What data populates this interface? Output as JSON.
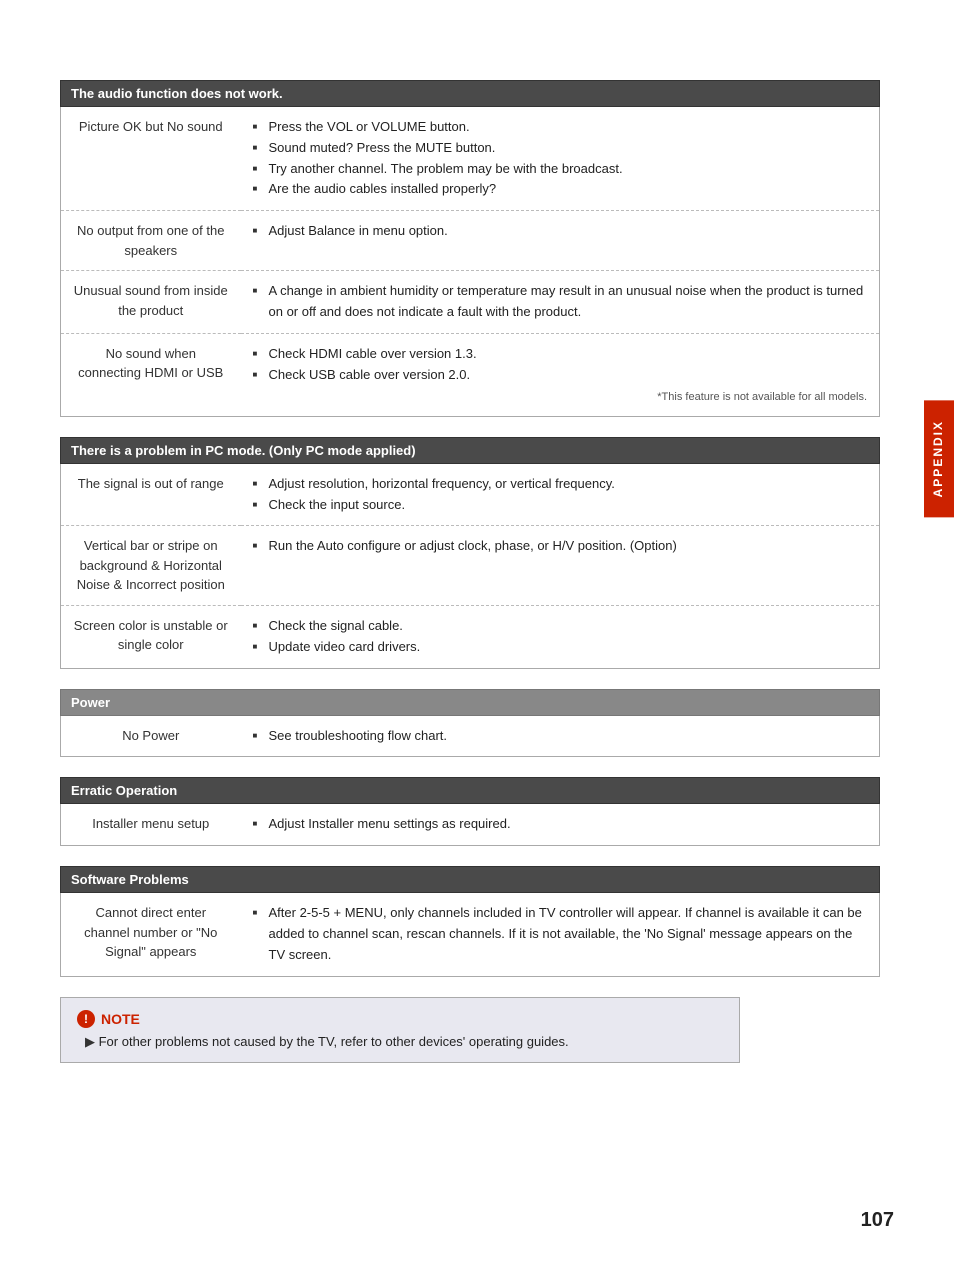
{
  "sections": [
    {
      "header": "The audio function does not work.",
      "header_type": "dark",
      "rows": [
        {
          "issue": "Picture OK but No sound",
          "solutions": [
            "Press the VOL or VOLUME button.",
            "Sound muted? Press the MUTE button.",
            "Try another channel. The problem may be with the broadcast.",
            "Are the audio cables installed properly?"
          ],
          "note": null
        },
        {
          "issue": "No output from one of the speakers",
          "solutions": [
            "Adjust Balance in menu option."
          ],
          "note": null
        },
        {
          "issue": "Unusual sound from inside the product",
          "solutions": [
            "A change in ambient humidity or temperature may result in an unusual noise when the product is turned on or off and does not indicate a fault with the product."
          ],
          "note": null
        },
        {
          "issue": "No sound when connecting HDMI or USB",
          "solutions": [
            "Check HDMI cable over version 1.3.",
            "Check USB cable over version 2.0."
          ],
          "note": "*This feature is not available for all models."
        }
      ]
    },
    {
      "header": "There is a problem in PC mode. (Only PC mode applied)",
      "header_type": "dark",
      "rows": [
        {
          "issue": "The signal is out of range",
          "solutions": [
            "Adjust resolution, horizontal frequency, or vertical frequency.",
            "Check the input source."
          ],
          "note": null
        },
        {
          "issue": "Vertical bar or stripe on background & Horizontal Noise & Incorrect position",
          "solutions": [
            "Run the Auto configure or adjust clock, phase, or H/V position. (Option)"
          ],
          "note": null
        },
        {
          "issue": "Screen color is unstable or single color",
          "solutions": [
            "Check the signal cable.",
            "Update video card drivers."
          ],
          "note": null
        }
      ]
    },
    {
      "header": "Power",
      "header_type": "medium",
      "rows": [
        {
          "issue": "No Power",
          "solutions": [
            "See troubleshooting flow chart."
          ],
          "note": null
        }
      ]
    },
    {
      "header": "Erratic Operation",
      "header_type": "dark",
      "rows": [
        {
          "issue": "Installer menu setup",
          "solutions": [
            "Adjust Installer menu settings as required."
          ],
          "note": null
        }
      ]
    },
    {
      "header": "Software Problems",
      "header_type": "dark",
      "rows": [
        {
          "issue": "Cannot direct enter channel number or \"No Signal\" appears",
          "solutions": [
            "After 2-5-5 + MENU, only channels included in TV controller will appear. If channel is available it can be added to channel scan, rescan channels. If it is not available, the 'No Signal' message appears on the TV screen."
          ],
          "note": null
        }
      ]
    }
  ],
  "note": {
    "title": "NOTE",
    "text": "For other problems not caused by the TV, refer to other devices' operating guides."
  },
  "page_number": "107",
  "appendix_label": "APPENDIX"
}
